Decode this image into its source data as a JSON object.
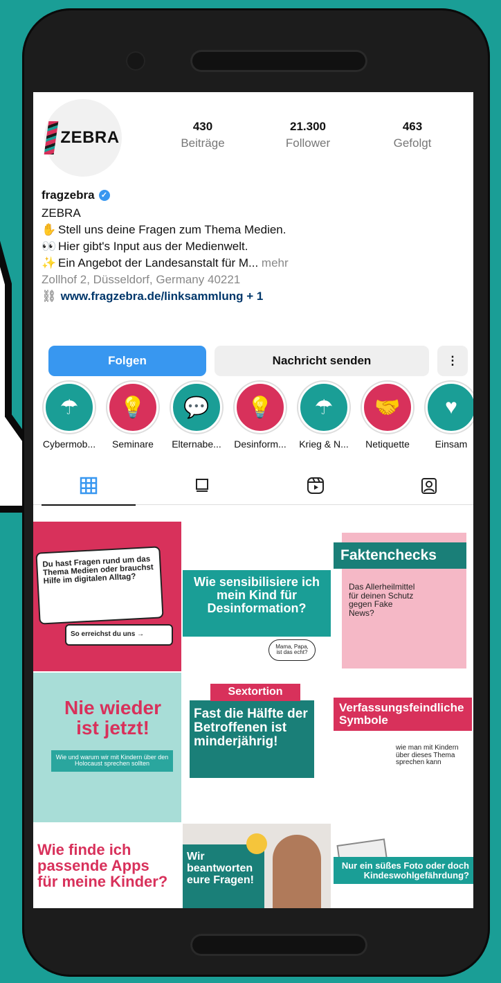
{
  "profile": {
    "avatar_text": "ZEBRA",
    "stats": [
      {
        "value": "430",
        "label": "Beiträge"
      },
      {
        "value": "21.300",
        "label": "Follower"
      },
      {
        "value": "463",
        "label": "Gefolgt"
      }
    ],
    "username": "fragzebra",
    "display_name": "ZEBRA",
    "bio_lines": [
      "Stell uns deine Fragen zum Thema Medien.",
      "Hier gibt's Input aus der Medienwelt.",
      "Ein Angebot der Landesanstalt für M..."
    ],
    "more": "mehr",
    "address": "Zollhof 2, Düsseldorf, Germany 40221",
    "link": "www.fragzebra.de/linksammlung + 1"
  },
  "actions": {
    "follow": "Folgen",
    "message": "Nachricht senden",
    "more": "⋮"
  },
  "highlights": [
    {
      "label": "Cybermob...",
      "icon": "cloud-rain-icon",
      "color": "#1a9e96"
    },
    {
      "label": "Seminare",
      "icon": "lightbulb-icon",
      "color": "#d8315b"
    },
    {
      "label": "Elternabe...",
      "icon": "speech-bubble-icon",
      "color": "#1a9e96"
    },
    {
      "label": "Desinform...",
      "icon": "lightbulb-icon",
      "color": "#d8315b"
    },
    {
      "label": "Krieg & N...",
      "icon": "cloud-rain-icon",
      "color": "#1a9e96"
    },
    {
      "label": "Netiquette",
      "icon": "handshake-icon",
      "color": "#d8315b"
    },
    {
      "label": "Einsam",
      "icon": "heart-icon",
      "color": "#1a9e96"
    }
  ],
  "posts": [
    {
      "text": "Du hast Fragen rund um das Thema Medien oder brauchst Hilfe im digitalen Alltag?",
      "sub": "So erreichst du uns →"
    },
    {
      "text": "Wie sensibilisiere ich mein Kind für Desinformation?",
      "sub": "Mama, Papa, ist das echt?"
    },
    {
      "text": "Faktenchecks",
      "sub": "Das Allerheilmittel für deinen Schutz gegen Fake News?"
    },
    {
      "text": "Nie wieder ist jetzt!",
      "sub": "Wie und warum wir mit Kindern über den Holocaust sprechen sollten"
    },
    {
      "text": "Sextortion",
      "sub": "Fast die Hälfte der Betroffenen ist minderjährig!"
    },
    {
      "text": "Verfassungsfeindliche Symbole",
      "sub": "wie man mit Kindern über dieses Thema sprechen kann"
    },
    {
      "text": "Wie finde ich passende Apps für meine Kinder?",
      "sub": ""
    },
    {
      "text": "Wir beantworten eure Fragen!",
      "sub": ""
    },
    {
      "text": "Nur ein süßes Foto oder doch Kindeswohlgefährdung?",
      "sub": ""
    }
  ],
  "colors": {
    "teal": "#1a9e96",
    "pink": "#d8315b",
    "blue": "#3897f0"
  }
}
